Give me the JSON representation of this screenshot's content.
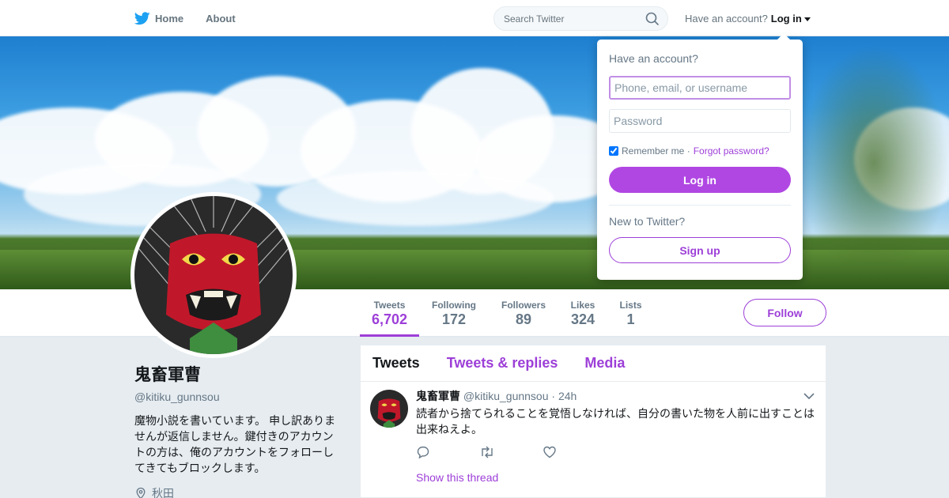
{
  "nav": {
    "home_label": "Home",
    "about_label": "About",
    "search_placeholder": "Search Twitter",
    "account_prompt": "Have an account?",
    "login_label": "Log in"
  },
  "profile": {
    "name": "鬼畜軍曹",
    "handle": "@kitiku_gunnsou",
    "bio": "魔物小説を書いています。 申し訳ありませんが返信しません。鍵付きのアカウントの方は、俺のアカウントをフォローしてきてもブロックします。",
    "location": "秋田"
  },
  "stats": [
    {
      "label": "Tweets",
      "value": "6,702",
      "active": true
    },
    {
      "label": "Following",
      "value": "172"
    },
    {
      "label": "Followers",
      "value": "89"
    },
    {
      "label": "Likes",
      "value": "324"
    },
    {
      "label": "Lists",
      "value": "1"
    }
  ],
  "follow_label": "Follow",
  "timeline": {
    "tabs": [
      "Tweets",
      "Tweets & replies",
      "Media"
    ],
    "tweet": {
      "name": "鬼畜軍曹",
      "handle": "@kitiku_gunnsou",
      "time": "· 24h",
      "text": "読者から捨てられることを覚悟しなければ、自分の書いた物を人前に出すことは出来ねえよ。",
      "show_thread": "Show this thread"
    }
  },
  "login_dropdown": {
    "title": "Have an account?",
    "username_placeholder": "Phone, email, or username",
    "password_placeholder": "Password",
    "remember_label": "Remember me ·",
    "forgot_label": "Forgot password?",
    "login_button": "Log in",
    "new_prompt": "New to Twitter?",
    "signup_button": "Sign up"
  },
  "colors": {
    "accent": "#9d3fd8",
    "login_button": "#b047e3",
    "twitter_blue": "#1da1f2"
  }
}
